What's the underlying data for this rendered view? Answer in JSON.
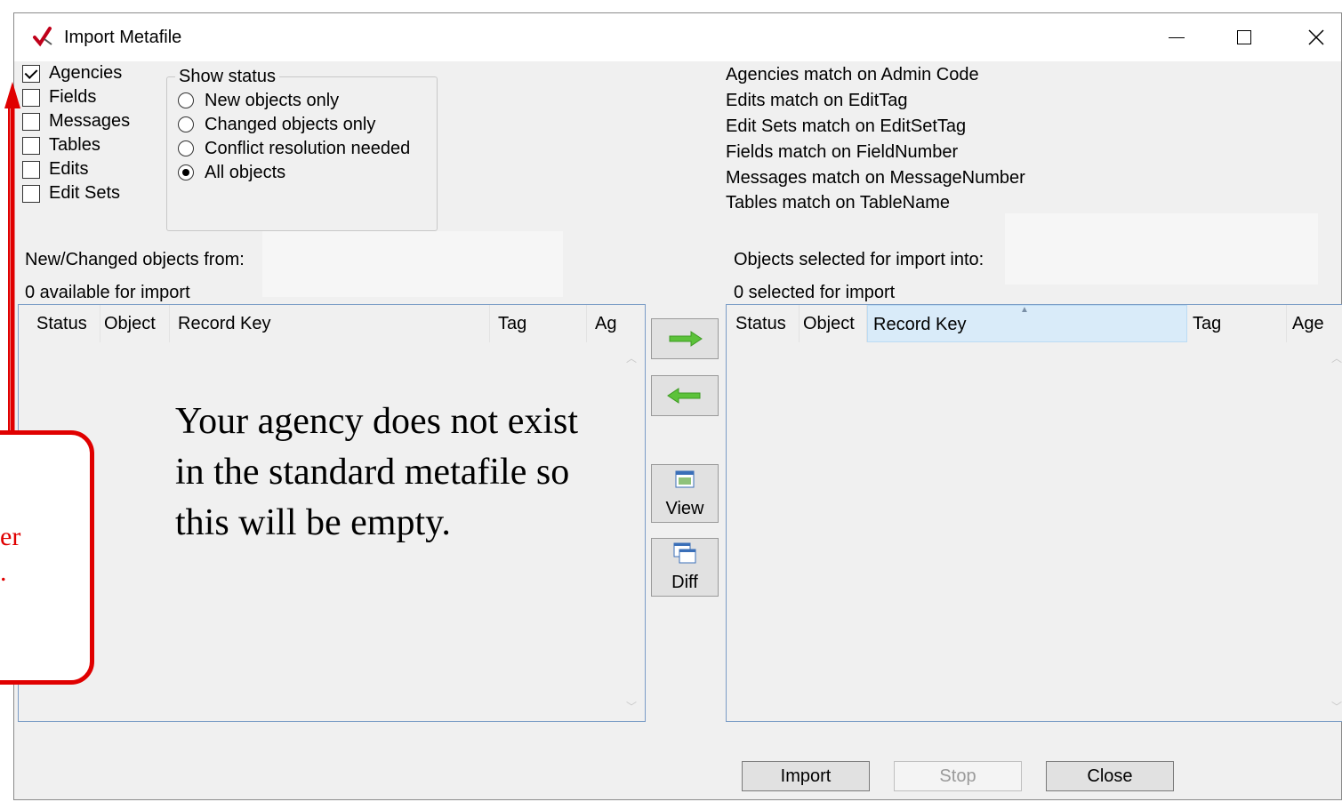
{
  "window": {
    "title": "Import Metafile",
    "minimize": "—",
    "maximize": "☐",
    "close": "✕"
  },
  "object_types": [
    {
      "label": "Agencies",
      "checked": true
    },
    {
      "label": "Fields",
      "checked": false
    },
    {
      "label": "Messages",
      "checked": false
    },
    {
      "label": "Tables",
      "checked": false
    },
    {
      "label": "Edits",
      "checked": false
    },
    {
      "label": "Edit Sets",
      "checked": false
    }
  ],
  "show_status": {
    "label": "Show status",
    "options": [
      {
        "label": "New objects only",
        "selected": false
      },
      {
        "label": "Changed objects only",
        "selected": false
      },
      {
        "label": "Conflict resolution needed",
        "selected": false
      },
      {
        "label": "All objects",
        "selected": true
      }
    ]
  },
  "match_info": [
    "Agencies match on Admin Code",
    "Edits match on EditTag",
    "Edit Sets match on EditSetTag",
    "Fields match on FieldNumber",
    "Messages match on MessageNumber",
    "Tables match on TableName"
  ],
  "left_panel": {
    "heading": "New/Changed objects from:",
    "count": "0 available for import",
    "columns": [
      "Status",
      "Object",
      "Record Key",
      "Tag",
      "Ag"
    ]
  },
  "right_panel": {
    "heading": "Objects selected for import into:",
    "count": "0 selected for import",
    "columns": [
      "Status",
      "Object",
      "Record Key",
      "Tag",
      "Age"
    ]
  },
  "side_buttons": {
    "view": "View",
    "diff": "Diff"
  },
  "bottom_buttons": {
    "import": "Import",
    "stop": "Stop",
    "close": "Close"
  },
  "annotation": {
    "note": "Your agency does not exist in the standard metafile so this will be empty.",
    "callout_line1": "er",
    "callout_line2": "."
  },
  "colors": {
    "callout": "#e00000",
    "arrow_right": "#5cc23a",
    "arrow_left": "#5cc23a",
    "list_border": "#7a9cc6"
  }
}
